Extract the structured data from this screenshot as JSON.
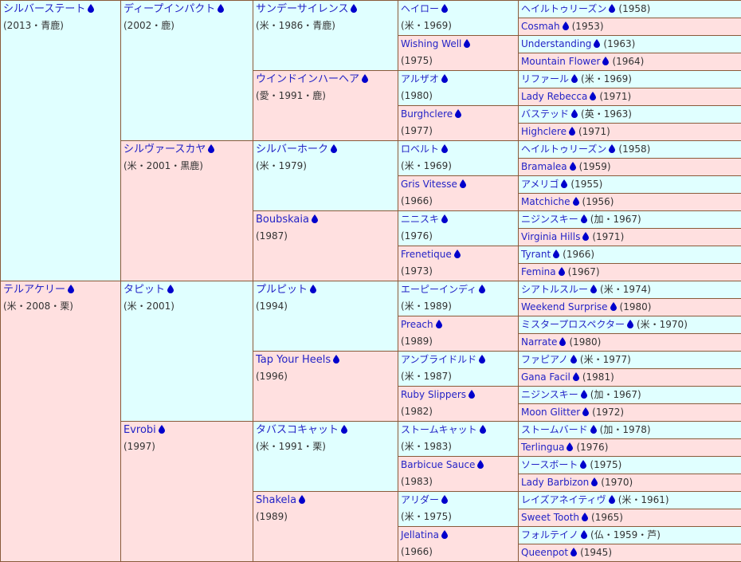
{
  "icon_color": "#0000cc",
  "male_bg": "#e0ffff",
  "female_bg": "#ffe0e0",
  "g1": [
    {
      "name": "シルバーステート",
      "info": "(2013・青鹿)",
      "sex": "m"
    },
    {
      "name": "テルアケリー",
      "info": "(米・2008・栗)",
      "sex": "f"
    }
  ],
  "g2": [
    {
      "name": "ディープインパクト",
      "info": "(2002・鹿)",
      "sex": "m"
    },
    {
      "name": "シルヴァースカヤ",
      "info": "(米・2001・黒鹿)",
      "sex": "f"
    },
    {
      "name": "タピット",
      "info": "(米・2001)",
      "sex": "m"
    },
    {
      "name": "Evrobi",
      "info": "(1997)",
      "sex": "f"
    }
  ],
  "g3": [
    {
      "name": "サンデーサイレンス",
      "info": "(米・1986・青鹿)",
      "sex": "m"
    },
    {
      "name": "ウインドインハーヘア",
      "info": "(愛・1991・鹿)",
      "sex": "f"
    },
    {
      "name": "シルバーホーク",
      "info": "(米・1979)",
      "sex": "m"
    },
    {
      "name": "Boubskaia",
      "info": "(1987)",
      "sex": "f"
    },
    {
      "name": "プルピット",
      "info": "(1994)",
      "sex": "m"
    },
    {
      "name": "Tap Your Heels",
      "info": "(1996)",
      "sex": "f"
    },
    {
      "name": "タバスコキャット",
      "info": "(米・1991・栗)",
      "sex": "m"
    },
    {
      "name": "Shakela",
      "info": "(1989)",
      "sex": "f"
    }
  ],
  "g4": [
    {
      "name": "ヘイロー",
      "info": "(米・1969)",
      "sex": "m"
    },
    {
      "name": "Wishing Well",
      "info": "(1975)",
      "sex": "f"
    },
    {
      "name": "アルザオ",
      "info": "(1980)",
      "sex": "m"
    },
    {
      "name": "Burghclere",
      "info": "(1977)",
      "sex": "f"
    },
    {
      "name": "ロベルト",
      "info": "(米・1969)",
      "sex": "m"
    },
    {
      "name": "Gris Vitesse",
      "info": "(1966)",
      "sex": "f"
    },
    {
      "name": "ニニスキ",
      "info": "(1976)",
      "sex": "m"
    },
    {
      "name": "Frenetique",
      "info": "(1973)",
      "sex": "f"
    },
    {
      "name": "エーピーインディ",
      "info": "(米・1989)",
      "sex": "m"
    },
    {
      "name": "Preach",
      "info": "(1989)",
      "sex": "f"
    },
    {
      "name": "アンブライドルド",
      "info": "(米・1987)",
      "sex": "m"
    },
    {
      "name": "Ruby Slippers",
      "info": "(1982)",
      "sex": "f"
    },
    {
      "name": "ストームキャット",
      "info": "(米・1983)",
      "sex": "m"
    },
    {
      "name": "Barbicue Sauce",
      "info": "(1983)",
      "sex": "f"
    },
    {
      "name": "アリダー",
      "info": "(米・1975)",
      "sex": "m"
    },
    {
      "name": "Jellatina",
      "info": "(1966)",
      "sex": "f"
    }
  ],
  "g5": [
    {
      "name": "ヘイルトゥリーズン",
      "info": "(1958)",
      "sex": "m"
    },
    {
      "name": "Cosmah",
      "info": "(1953)",
      "sex": "f"
    },
    {
      "name": "Understanding",
      "info": "(1963)",
      "sex": "m"
    },
    {
      "name": "Mountain Flower",
      "info": "(1964)",
      "sex": "f"
    },
    {
      "name": "リファール",
      "info": "(米・1969)",
      "sex": "m"
    },
    {
      "name": "Lady Rebecca",
      "info": "(1971)",
      "sex": "f"
    },
    {
      "name": "バステッド",
      "info": "(英・1963)",
      "sex": "m"
    },
    {
      "name": "Highclere",
      "info": "(1971)",
      "sex": "f"
    },
    {
      "name": "ヘイルトゥリーズン",
      "info": "(1958)",
      "sex": "m"
    },
    {
      "name": "Bramalea",
      "info": "(1959)",
      "sex": "f"
    },
    {
      "name": "アメリゴ",
      "info": "(1955)",
      "sex": "m"
    },
    {
      "name": "Matchiche",
      "info": "(1956)",
      "sex": "f"
    },
    {
      "name": "ニジンスキー",
      "info": "(加・1967)",
      "sex": "m"
    },
    {
      "name": "Virginia Hills",
      "info": "(1971)",
      "sex": "f"
    },
    {
      "name": "Tyrant",
      "info": "(1966)",
      "sex": "m"
    },
    {
      "name": "Femina",
      "info": "(1967)",
      "sex": "f"
    },
    {
      "name": "シアトルスルー",
      "info": "(米・1974)",
      "sex": "m"
    },
    {
      "name": "Weekend Surprise",
      "info": "(1980)",
      "sex": "f"
    },
    {
      "name": "ミスタープロスペクター",
      "info": "(米・1970)",
      "sex": "m"
    },
    {
      "name": "Narrate",
      "info": "(1980)",
      "sex": "f"
    },
    {
      "name": "ファピアノ",
      "info": "(米・1977)",
      "sex": "m"
    },
    {
      "name": "Gana Facil",
      "info": "(1981)",
      "sex": "f"
    },
    {
      "name": "ニジンスキー",
      "info": "(加・1967)",
      "sex": "m"
    },
    {
      "name": "Moon Glitter",
      "info": "(1972)",
      "sex": "f"
    },
    {
      "name": "ストームバード",
      "info": "(加・1978)",
      "sex": "m"
    },
    {
      "name": "Terlingua",
      "info": "(1976)",
      "sex": "f"
    },
    {
      "name": "ソースボート",
      "info": "(1975)",
      "sex": "m"
    },
    {
      "name": "Lady Barbizon",
      "info": "(1970)",
      "sex": "f"
    },
    {
      "name": "レイズアネイティヴ",
      "info": "(米・1961)",
      "sex": "m"
    },
    {
      "name": "Sweet Tooth",
      "info": "(1965)",
      "sex": "f"
    },
    {
      "name": "フォルテイノ",
      "info": "(仏・1959・芦)",
      "sex": "m"
    },
    {
      "name": "Queenpot",
      "info": "(1945)",
      "sex": "f"
    }
  ]
}
